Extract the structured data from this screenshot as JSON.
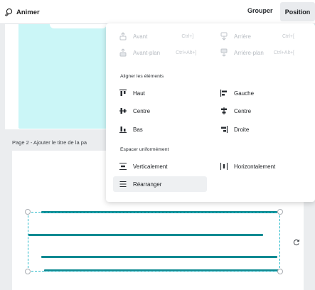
{
  "toolbar": {
    "animate_label": "Animer",
    "group_label": "Grouper",
    "position_label": "Position"
  },
  "page2": {
    "title": "Page 2 - Ajouter le titre de la pa"
  },
  "position_menu": {
    "layer_items": [
      {
        "label": "Avant",
        "shortcut": "Ctrl+]",
        "icon": "bring-forward-icon"
      },
      {
        "label": "Arrière",
        "shortcut": "Ctrl+[",
        "icon": "send-backward-icon"
      },
      {
        "label": "Avant-plan",
        "shortcut": "Ctrl+Alt+]",
        "icon": "bring-to-front-icon"
      },
      {
        "label": "Arrière-plan",
        "shortcut": "Ctrl+Alt+[",
        "icon": "send-to-back-icon"
      }
    ],
    "align_heading": "Aligner les éléments",
    "align_items": [
      {
        "label": "Haut",
        "icon": "align-top-icon"
      },
      {
        "label": "Gauche",
        "icon": "align-left-icon"
      },
      {
        "label": "Centre",
        "icon": "align-middle-icon"
      },
      {
        "label": "Centre",
        "icon": "align-center-icon"
      },
      {
        "label": "Bas",
        "icon": "align-bottom-icon"
      },
      {
        "label": "Droite",
        "icon": "align-right-icon"
      }
    ],
    "distribute_heading": "Espacer uniformément",
    "distribute_items": [
      {
        "label": "Verticalement",
        "icon": "distribute-vertical-icon"
      },
      {
        "label": "Horizontalement",
        "icon": "distribute-horizontal-icon"
      }
    ],
    "tidy_item": {
      "label": "Réarranger",
      "icon": "tidy-up-icon"
    }
  },
  "colors": {
    "accent": "#0f8a92",
    "page_fill": "#cbf6f7",
    "selection": "#1cb7c7"
  }
}
